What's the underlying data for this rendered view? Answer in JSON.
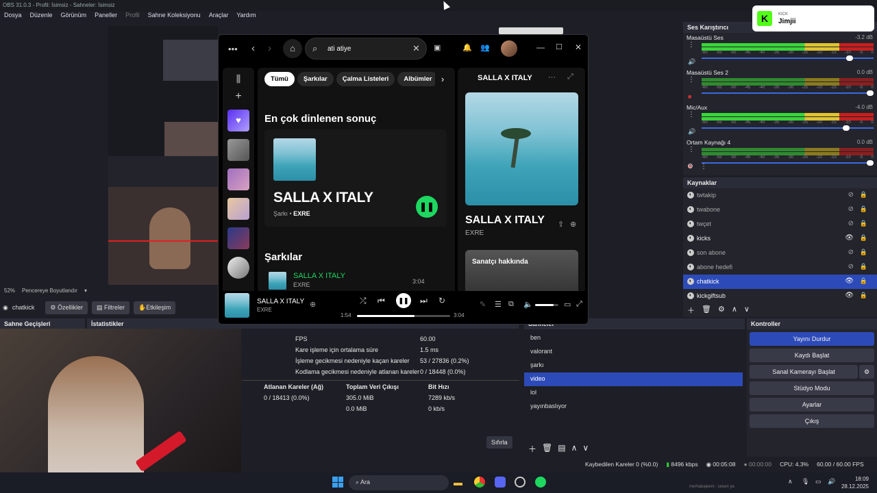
{
  "obs": {
    "title": "OBS 31.0.3 - Profil: İsimsiz - Sahneler: İsimsiz",
    "menu": [
      "Dosya",
      "Düzenle",
      "Görünüm",
      "Paneller",
      "Profil",
      "Sahne Koleksiyonu",
      "Araçlar",
      "Yardım"
    ],
    "zoom": "52%",
    "zoom_mode": "Pencereye Boyutlandır",
    "selected_source": "chatkick",
    "source_buttons": {
      "properties": "Özellikler",
      "filters": "Filtreler",
      "interact": "Etkileşim"
    },
    "docks": {
      "transitions": "Sahne Geçişleri",
      "stats": "İstatistikler",
      "scenes": "Sahneler",
      "controls": "Kontroller",
      "mixer": "Ses Karıştırıcı",
      "sources": "Kaynaklar"
    },
    "stats": {
      "rows": [
        {
          "label": "FPS",
          "value": "60.00"
        },
        {
          "label": "Kare işleme için ortalama süre",
          "value": "1.5 ms"
        },
        {
          "label": "İşleme gecikmesi nedeniyle kaçan kareler",
          "value": "53 / 27836 (0.2%)"
        },
        {
          "label": "Kodlama gecikmesi nedeniyle atlanan kareler",
          "value": "0 / 18448 (0.0%)"
        }
      ],
      "headers": [
        "Atlanan Kareler (Ağ)",
        "Toplam Veri Çıkışı",
        "Bit Hızı"
      ],
      "stream_row": [
        "0 / 18413 (0.0%)",
        "305.0 MiB",
        "7289 kb/s"
      ],
      "record_row": [
        "",
        "0.0 MiB",
        "0 kb/s"
      ],
      "reset": "Sıfırla"
    },
    "scenes": [
      {
        "name": "ben"
      },
      {
        "name": "valorant"
      },
      {
        "name": "şarkı"
      },
      {
        "name": "video",
        "selected": true
      },
      {
        "name": "lol"
      },
      {
        "name": "yayınbaslıyor"
      }
    ],
    "controls": [
      "Yayını Durdur",
      "Kaydı Başlat",
      "Sanal Kamerayı Başlat",
      "Stüdyo Modu",
      "Ayarlar",
      "Çıkış"
    ],
    "mixer": [
      {
        "name": "Masaüstü Ses",
        "value": "-3.2 dB",
        "active": true,
        "volume": 0.88
      },
      {
        "name": "Masaüstü Ses 2",
        "value": "0.0 dB",
        "active": false,
        "volume": 1.0
      },
      {
        "name": "Mic/Aux",
        "value": "-4.0 dB",
        "active": true,
        "volume": 0.86
      },
      {
        "name": "Ortam Kaynağı 4",
        "value": "0.0 dB",
        "active": false,
        "volume": 1.0
      }
    ],
    "meter_ticks": [
      "-60",
      "-55",
      "-50",
      "-45",
      "-40",
      "-35",
      "-30",
      "-25",
      "-20",
      "-15",
      "-10",
      "-5",
      "0"
    ],
    "sources": [
      {
        "name": "twtakip",
        "visible": false
      },
      {
        "name": "twabone",
        "visible": false
      },
      {
        "name": "twçet",
        "visible": false
      },
      {
        "name": "kicks",
        "visible": true
      },
      {
        "name": "son abone",
        "visible": false
      },
      {
        "name": "abone hedefi",
        "visible": false
      },
      {
        "name": "chatkick",
        "visible": true,
        "selected": true
      },
      {
        "name": "kickgiftsub",
        "visible": true
      }
    ],
    "status": {
      "dropped": "Kaybedilen Kareler 0 (%0.0)",
      "bitrate": "8496 kbps",
      "stream_time": "00:05:08",
      "rec_time": "00:00:00",
      "cpu": "CPU: 4.3%",
      "fps": "60.00 / 60.00 FPS"
    }
  },
  "kick_alert": {
    "tag": "KICK",
    "name": "Jimjii"
  },
  "spotify": {
    "search_value": "ati atiye",
    "chips": [
      "Tümü",
      "Şarkılar",
      "Çalma Listeleri",
      "Albümler"
    ],
    "top_result_heading": "En çok dinlenen sonuç",
    "top_title": "SALLA X ITALY",
    "top_type": "Şarkı",
    "top_artist": "EXRE",
    "songs_heading": "Şarkılar",
    "song_row": {
      "title": "SALLA X ITALY",
      "artist": "EXRE",
      "duration": "3:04"
    },
    "right_title": "SALLA X ITALY",
    "right_artist": "EXRE",
    "about_artist": "Sanatçı hakkında",
    "player": {
      "title": "SALLA X ITALY",
      "artist": "EXRE",
      "elapsed": "1:54",
      "total": "3:04",
      "progress": 0.62,
      "volume": 0.8
    }
  },
  "taskbar": {
    "search": "Ara",
    "time": "18:09",
    "date": "28.12.2025",
    "ticker": "merhabajeem : selam ya"
  },
  "colors": {
    "accent": "#2d4bb8",
    "spotify_green": "#1ed760",
    "kick_green": "#53fc18"
  }
}
